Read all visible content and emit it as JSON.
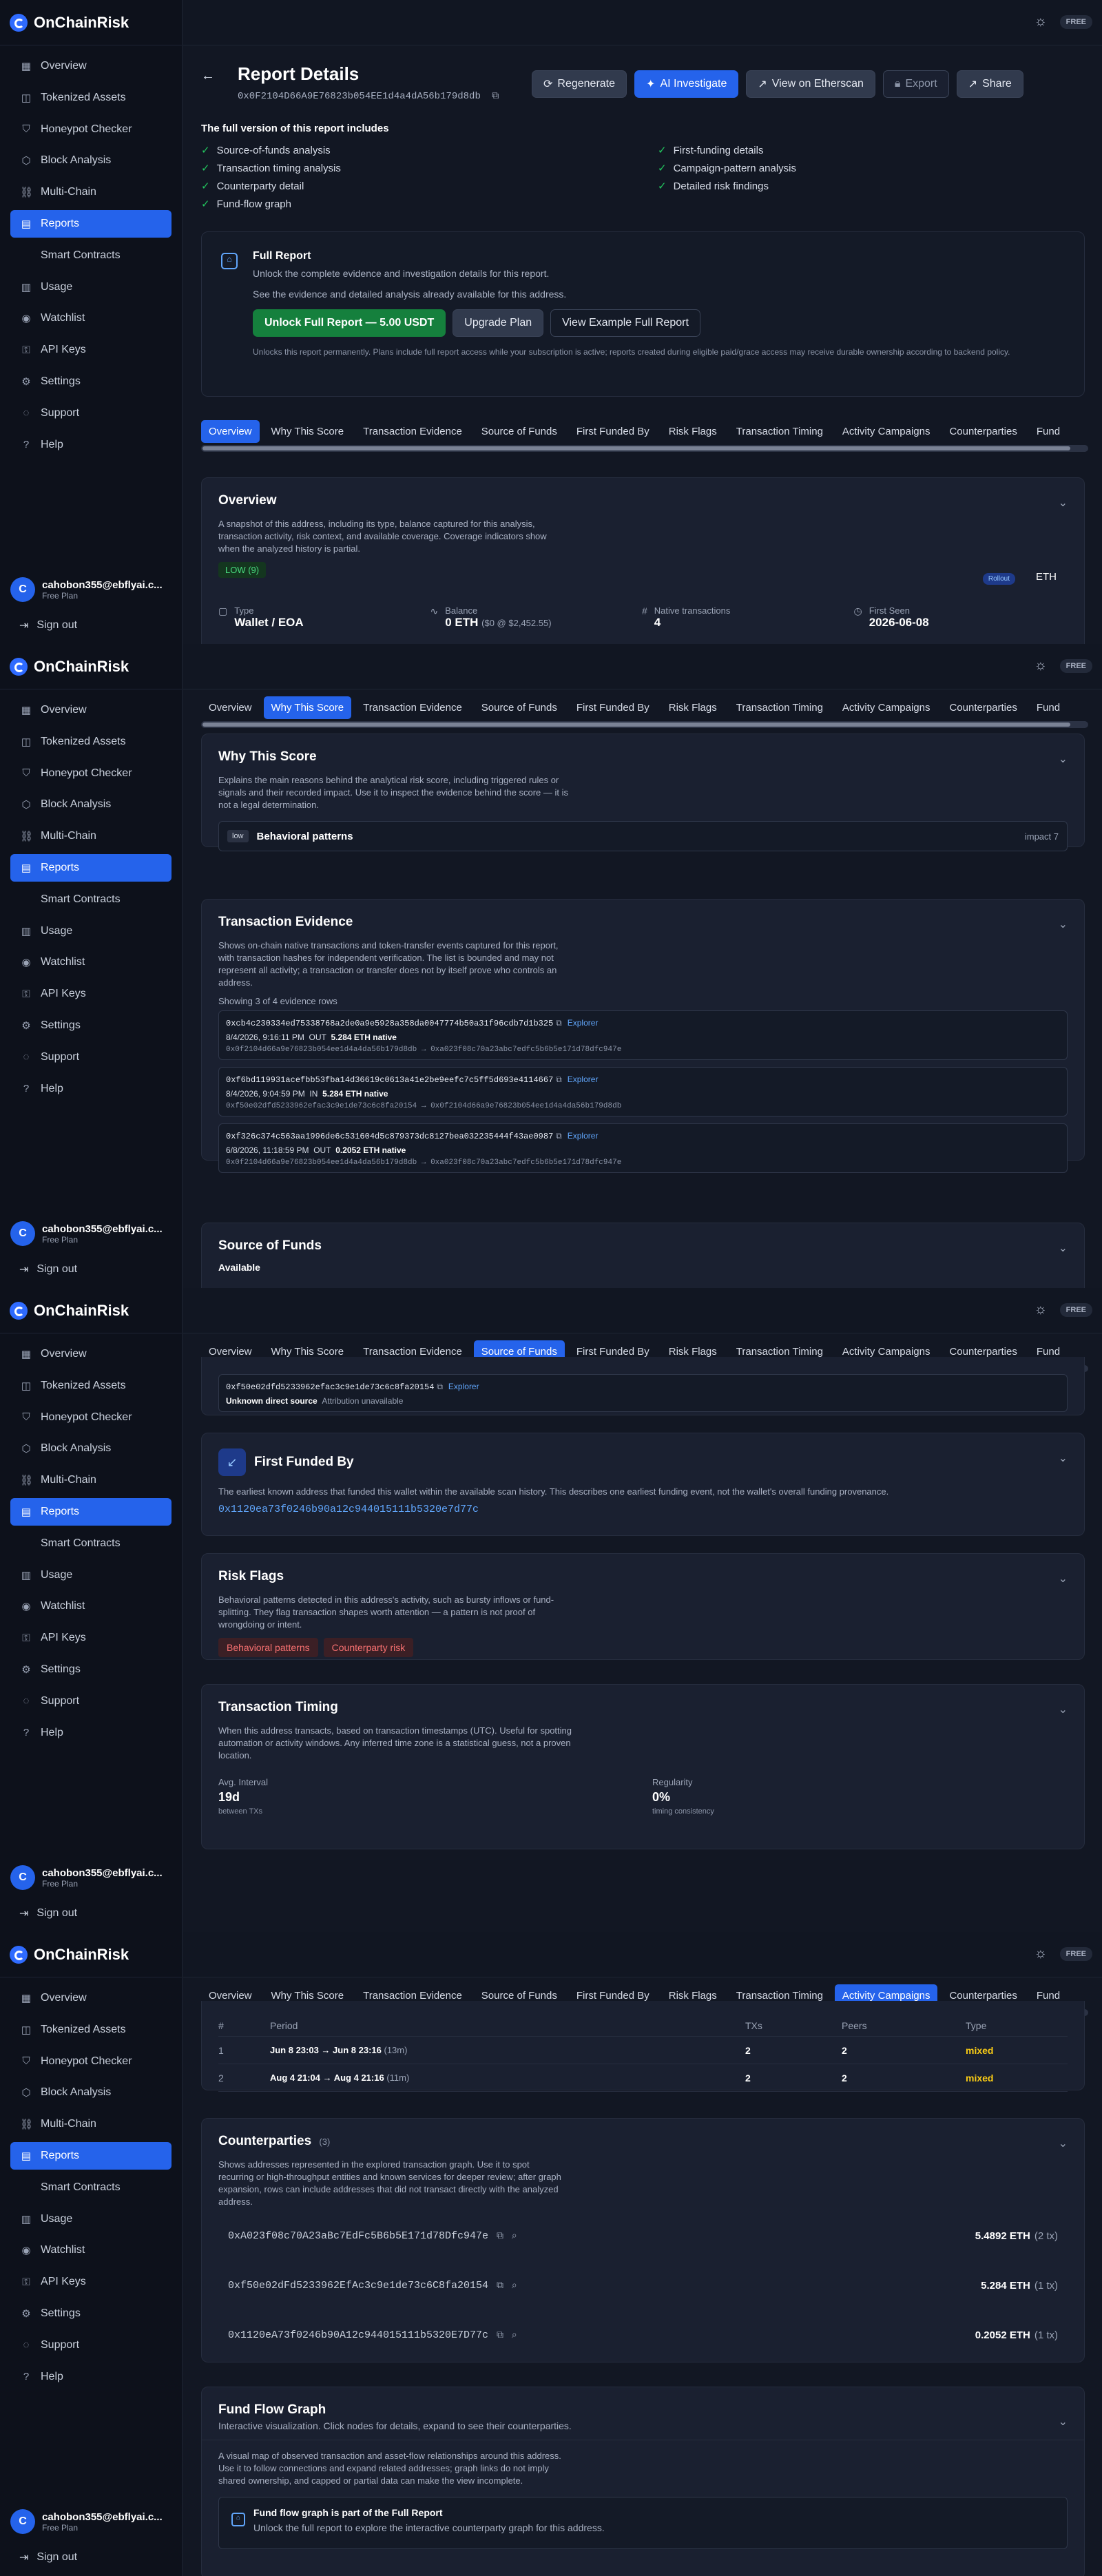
{
  "app": {
    "name": "OnChainRisk",
    "badge": "FREE"
  },
  "nav": [
    {
      "label": "Overview",
      "icon": "grid-icon"
    },
    {
      "label": "Tokenized Assets",
      "icon": "database-icon"
    },
    {
      "label": "Honeypot Checker",
      "icon": "shield-icon"
    },
    {
      "label": "Block Analysis",
      "icon": "cube-icon"
    },
    {
      "label": "Multi-Chain",
      "icon": "link-icon"
    },
    {
      "label": "Reports",
      "icon": "file-icon"
    },
    {
      "label": "Smart Contracts",
      "icon": "code-icon"
    },
    {
      "label": "Usage",
      "icon": "chart-icon"
    },
    {
      "label": "Watchlist",
      "icon": "eye-icon"
    },
    {
      "label": "API Keys",
      "icon": "key-icon"
    },
    {
      "label": "Settings",
      "icon": "gear-icon"
    },
    {
      "label": "Support",
      "icon": "help-icon"
    },
    {
      "label": "Help",
      "icon": "question-icon"
    }
  ],
  "user": {
    "initial": "C",
    "email": "cahobon355@ebflyai.c...",
    "plan": "Free Plan",
    "signout": "Sign out"
  },
  "header": {
    "title": "Report Details",
    "address": "0x0F2104D66A9E76823b054EE1d4a4dA56b179d8db",
    "buttons": {
      "regenerate": "Regenerate",
      "ai": "AI Investigate",
      "etherscan": "View on Etherscan",
      "export": "Export",
      "share": "Share"
    }
  },
  "includes": {
    "heading": "The full version of this report includes",
    "left": [
      "Source-of-funds analysis",
      "Transaction timing analysis",
      "Counterparty detail",
      "Fund-flow graph"
    ],
    "right": [
      "First-funding details",
      "Campaign-pattern analysis",
      "Detailed risk findings"
    ]
  },
  "full_report": {
    "title": "Full Report",
    "line1": "Unlock the complete evidence and investigation details for this report.",
    "line2": "See the evidence and detailed analysis already available for this address.",
    "unlock": "Unlock Full Report — 5.00 USDT",
    "upgrade": "Upgrade Plan",
    "example": "View Example Full Report",
    "note": "Unlocks this report permanently. Plans include full report access while your subscription is active; reports created during eligible paid/grace access may receive durable ownership according to backend policy."
  },
  "tabs": [
    "Overview",
    "Why This Score",
    "Transaction Evidence",
    "Source of Funds",
    "First Funded By",
    "Risk Flags",
    "Transaction Timing",
    "Activity Campaigns",
    "Counterparties",
    "Fund"
  ],
  "overview": {
    "title": "Overview",
    "desc": "A snapshot of this address, including its type, balance captured for this analysis, transaction activity, risk context, and available coverage. Coverage indicators show when the analyzed history is partial.",
    "risk": "LOW (9)",
    "rollout": "Rollout",
    "chain": "ETH",
    "type_label": "Type",
    "type_value": "Wallet / EOA",
    "balance_label": "Balance",
    "balance_value": "0 ETH",
    "balance_usd": "($0 @ $2,452.55)",
    "native_label": "Native transactions",
    "native_value": "4",
    "first_label": "First Seen",
    "first_value": "2026-06-08"
  },
  "why": {
    "title": "Why This Score",
    "desc": "Explains the main reasons behind the analytical risk score, including triggered rules or signals and their recorded impact. Use it to inspect the evidence behind the score — it is not a legal determination.",
    "level": "low",
    "reason": "Behavioral patterns",
    "impact": "impact 7"
  },
  "evidence": {
    "title": "Transaction Evidence",
    "desc": "Shows on-chain native transactions and token-transfer events captured for this report, with transaction hashes for independent verification. The list is bounded and may not represent all activity; a transaction or transfer does not by itself prove who controls an address.",
    "count": "Showing 3 of 4 evidence rows",
    "explorer": "Explorer",
    "rows": [
      {
        "hash": "0xcb4c230334ed75338768a2de0a9e5928a358da0047774b50a31f96cdb7d1b325",
        "date": "8/4/2026, 9:16:11 PM",
        "dir": "OUT",
        "amount": "5.284 ETH native",
        "from": "0x0f2104d66a9e76823b054ee1d4a4da56b179d8db",
        "to": "0xa023f08c70a23abc7edfc5b6b5e171d78dfc947e"
      },
      {
        "hash": "0xf6bd119931acefbb53fba14d36619c0613a41e2be9eefc7c5ff5d693e4114667",
        "date": "8/4/2026, 9:04:59 PM",
        "dir": "IN",
        "amount": "5.284 ETH native",
        "from": "0xf50e02dfd5233962efac3c9e1de73c6c8fa20154",
        "to": "0x0f2104d66a9e76823b054ee1d4a4da56b179d8db"
      },
      {
        "hash": "0xf326c374c563aa1996de6c531604d5c879373dc8127bea032235444f43ae0987",
        "date": "6/8/2026, 11:18:59 PM",
        "dir": "OUT",
        "amount": "0.2052 ETH native",
        "from": "0x0f2104d66a9e76823b054ee1d4a4da56b179d8db",
        "to": "0xa023f08c70a23abc7edfc5b6b5e171d78dfc947e"
      }
    ]
  },
  "sof": {
    "title": "Source of Funds",
    "status": "Available",
    "address": "0xf50e02dfd5233962efac3c9e1de73c6c8fa20154",
    "explorer": "Explorer",
    "source": "Unknown direct source",
    "attrib": "Attribution unavailable"
  },
  "ffb": {
    "title": "First Funded By",
    "desc": "The earliest known address that funded this wallet within the available scan history. This describes one earliest funding event, not the wallet's overall funding provenance.",
    "address": "0x1120ea73f0246b90a12c944015111b5320e7d77c"
  },
  "flags": {
    "title": "Risk Flags",
    "desc": "Behavioral patterns detected in this address's activity, such as bursty inflows or fund-splitting. They flag transaction shapes worth attention — a pattern is not proof of wrongdoing or intent.",
    "items": [
      "Behavioral patterns",
      "Counterparty risk"
    ]
  },
  "timing": {
    "title": "Transaction Timing",
    "desc": "When this address transacts, based on transaction timestamps (UTC). Useful for spotting automation or activity windows. Any inferred time zone is a statistical guess, not a proven location.",
    "avg_label": "Avg. Interval",
    "avg_value": "19d",
    "avg_sub": "between TXs",
    "reg_label": "Regularity",
    "reg_value": "0%",
    "reg_sub": "timing consistency"
  },
  "campaigns": {
    "headers": [
      "#",
      "Period",
      "TXs",
      "Peers",
      "Type"
    ],
    "rows": [
      {
        "n": "1",
        "period": "Jun 8 23:03 → Jun 8 23:16",
        "dur": "(13m)",
        "txs": "2",
        "peers": "2",
        "type": "mixed"
      },
      {
        "n": "2",
        "period": "Aug 4 21:04 → Aug 4 21:16",
        "dur": "(11m)",
        "txs": "2",
        "peers": "2",
        "type": "mixed"
      }
    ]
  },
  "counterparties": {
    "title": "Counterparties",
    "count": "(3)",
    "desc": "Shows addresses represented in the explored transaction graph. Use it to spot recurring or high-throughput entities and known services for deeper review; after graph expansion, rows can include addresses that did not transact directly with the analyzed address.",
    "rows": [
      {
        "addr": "0xA023f08c70A23aBc7EdFc5B6b5E171d78Dfc947e",
        "val": "5.4892 ETH",
        "cnt": "(2 tx)"
      },
      {
        "addr": "0xf50e02dFd5233962EfAc3c9e1de73c6C8fa20154",
        "val": "5.284 ETH",
        "cnt": "(1 tx)"
      },
      {
        "addr": "0x1120eA73f0246b90A12c944015111b5320E7D77c",
        "val": "0.2052 ETH",
        "cnt": "(1 tx)"
      }
    ]
  },
  "graph": {
    "title": "Fund Flow Graph",
    "subtitle": "Interactive visualization. Click nodes for details, expand to see their counterparties.",
    "desc": "A visual map of observed transaction and asset-flow relationships around this address. Use it to follow connections and expand related addresses; graph links do not imply shared ownership, and capped or partial data can make the view incomplete.",
    "lock_title": "Fund flow graph is part of the Full Report",
    "lock_desc": "Unlock the full report to explore the interactive counterparty graph for this address."
  },
  "colors": {
    "accent": "#2563eb",
    "green": "#22c55e",
    "red": "#f87171",
    "yellow": "#facc15"
  }
}
